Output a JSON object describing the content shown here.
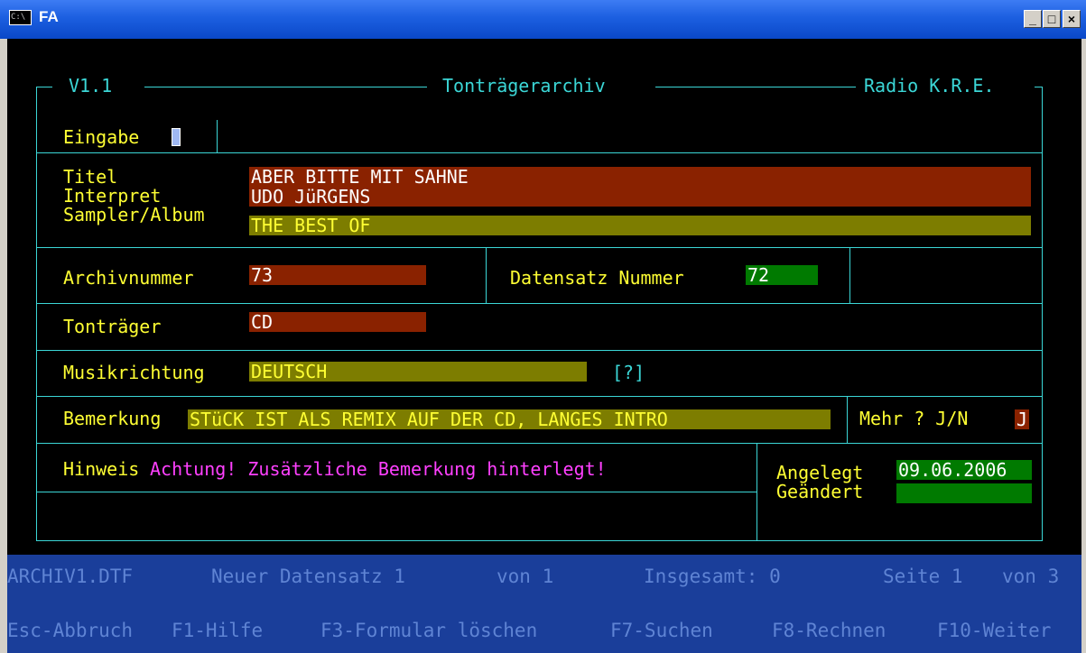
{
  "window": {
    "title": "FA",
    "icon_text": "C:\\",
    "minimize": "_",
    "maximize": "□",
    "close": "×"
  },
  "header": {
    "version": "V1.1",
    "title": "Tonträgerarchiv",
    "station": "Radio K.R.E."
  },
  "input": {
    "label": "Eingabe",
    "value": "F"
  },
  "record": {
    "title_label": "Titel",
    "title_value": "ABER BITTE MIT SAHNE",
    "artist_label": "Interpret",
    "artist_value": "UDO JüRGENS",
    "album_label": "Sampler/Album",
    "album_value": "THE BEST OF"
  },
  "archive": {
    "label": "Archivnummer",
    "value": "73"
  },
  "dataset": {
    "label": "Datensatz Nummer",
    "value": "72"
  },
  "carrier": {
    "label": "Tonträger",
    "value": "CD"
  },
  "genre": {
    "label": "Musikrichtung",
    "value": "DEUTSCH",
    "help": "[?]"
  },
  "remark": {
    "label": "Bemerkung",
    "value": "STüCK IST ALS REMIX AUF DER CD, LANGES INTRO"
  },
  "more": {
    "label": "Mehr ? J/N",
    "value": "J"
  },
  "hint": {
    "label": "Hinweis",
    "message": "Achtung! Zusätzliche Bemerkung hinterlegt!"
  },
  "dates": {
    "created_label": "Angelegt",
    "created_value": "09.06.2006",
    "changed_label": "Geändert",
    "changed_value": ""
  },
  "status": {
    "file": "ARCHIV1.DTF",
    "new_record": "Neuer Datensatz 1",
    "of_records": "von 1",
    "total": "Insgesamt: 0",
    "page": "Seite 1",
    "of_pages": "von 3"
  },
  "function_keys": [
    "Esc-Abbruch",
    "F1-Hilfe",
    "F3-Formular löschen",
    "F7-Suchen",
    "F8-Rechnen",
    "F10-Weiter"
  ],
  "colors": {
    "frame": "#3bd6d6",
    "label": "#ffff33",
    "field_red": "#8a2200",
    "field_olive": "#7d7d00",
    "field_green": "#007a00",
    "hint": "#ff40ff",
    "status_bg": "#1a3e9a",
    "status_text": "#5f84d4"
  }
}
